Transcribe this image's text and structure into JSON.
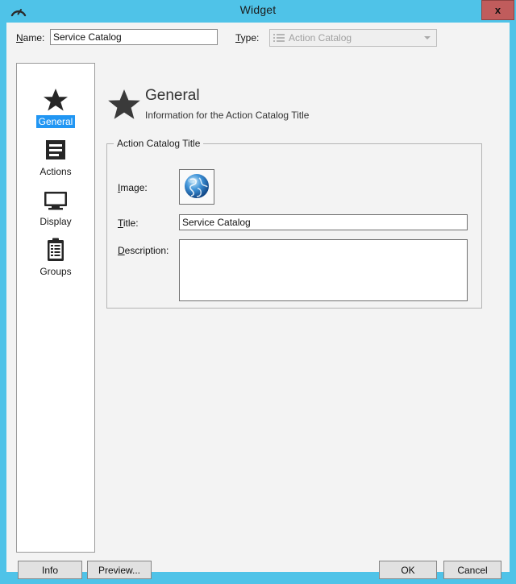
{
  "window": {
    "title": "Widget",
    "title_icon": "gauge-arc-icon",
    "close_label": "x",
    "border_color": "#4fc3e8",
    "background_color": "#f3f3f3",
    "accent_color": "#2196f3"
  },
  "top": {
    "name_label": "Name:",
    "name_mnemonic": "N",
    "name_value": "Service Catalog",
    "type_label": "Type:",
    "type_mnemonic": "T",
    "type_value": "Action Catalog",
    "type_icon": "list-icon",
    "type_disabled": true
  },
  "sidebar": {
    "items": [
      {
        "label": "General",
        "icon": "star-icon",
        "selected": true
      },
      {
        "label": "Actions",
        "icon": "list-block-icon",
        "selected": false
      },
      {
        "label": "Display",
        "icon": "monitor-icon",
        "selected": false
      },
      {
        "label": "Groups",
        "icon": "clipboard-icon",
        "selected": false
      }
    ]
  },
  "page": {
    "icon": "star-icon",
    "title": "General",
    "subtitle": "Information for the Action Catalog Title"
  },
  "groupbox": {
    "title": "Action Catalog Title",
    "image_label": "Image:",
    "image_mnemonic": "I",
    "image_icon": "globe-icon",
    "title_label": "Title:",
    "title_mnemonic": "T",
    "title_value": "Service Catalog",
    "description_label": "Description:",
    "description_mnemonic": "D",
    "description_value": ""
  },
  "buttons": {
    "info": "Info",
    "preview": "Preview...",
    "ok": "OK",
    "cancel": "Cancel"
  }
}
